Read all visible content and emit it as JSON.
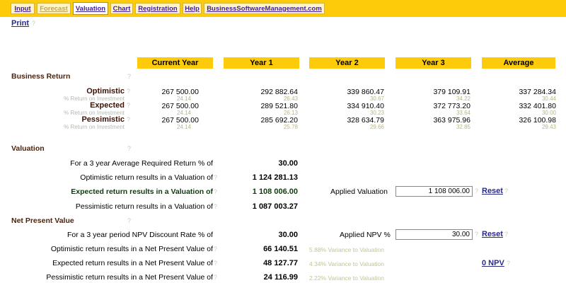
{
  "tabs": [
    {
      "label": "Input",
      "state": "normal"
    },
    {
      "label": "Forecast",
      "state": "disabled"
    },
    {
      "label": "Valuation",
      "state": "active"
    },
    {
      "label": "Chart",
      "state": "normal"
    },
    {
      "label": "Registration",
      "state": "normal"
    },
    {
      "label": "Help",
      "state": "normal"
    },
    {
      "label": "BusinessSoftwareManagement.com",
      "state": "normal"
    }
  ],
  "help_mark": "?",
  "print_label": "Print",
  "columns": [
    "Current Year",
    "Year 1",
    "Year 2",
    "Year 3",
    "Average"
  ],
  "business_return": {
    "title": "Business Return",
    "sub_label": "% Return on Investment",
    "rows": [
      {
        "label": "Optimistic",
        "values": [
          "267 500.00",
          "292 882.64",
          "339 860.47",
          "379 109.91",
          "337 284.34"
        ],
        "pcts": [
          "24.14",
          "26.43",
          "30.67",
          "34.22",
          "30.44"
        ]
      },
      {
        "label": "Expected",
        "values": [
          "267 500.00",
          "289 521.80",
          "334 910.40",
          "372 773.20",
          "332 401.80"
        ],
        "pcts": [
          "24.14",
          "26.13",
          "30.23",
          "33.64",
          "30.00"
        ]
      },
      {
        "label": "Pessimistic",
        "values": [
          "267 500.00",
          "285 692.20",
          "328 634.79",
          "363 975.96",
          "326 100.98"
        ],
        "pcts": [
          "24.14",
          "25.78",
          "29.66",
          "32.85",
          "29.43"
        ]
      }
    ]
  },
  "valuation": {
    "title": "Valuation",
    "required_return_label": "For a 3 year Average Required Return % of",
    "required_return_value": "30.00",
    "optimistic_label": "Optimistic return results in a Valuation of",
    "optimistic_value": "1 124 281.13",
    "expected_label": "Expected return results in a Valuation of",
    "expected_value": "1 108 006.00",
    "pessimistic_label": "Pessimistic return results in a Valuation of",
    "pessimistic_value": "1 087 003.27",
    "applied_label": "Applied Valuation",
    "applied_value": "1 108 006.00",
    "reset_label": "Reset"
  },
  "npv": {
    "title": "Net Present Value",
    "discount_label": "For a 3 year period NPV Discount Rate % of",
    "discount_value": "30.00",
    "applied_label": "Applied NPV %",
    "applied_value": "30.00",
    "reset_label": "Reset",
    "optimistic_label": "Optimistic return results in a Net Present Value of",
    "optimistic_value": "66 140.51",
    "optimistic_variance": "5.88% Variance to Valuation",
    "expected_label": "Expected return results in a Net Present Value of",
    "expected_value": "48 127.77",
    "expected_variance": "4.34% Variance to Valuation",
    "pessimistic_label": "Pessimistic return results in a Net Present Value of",
    "pessimistic_value": "24 116.99",
    "pessimistic_variance": "2.22% Variance to Valuation",
    "zero_npv_label": "0 NPV"
  }
}
